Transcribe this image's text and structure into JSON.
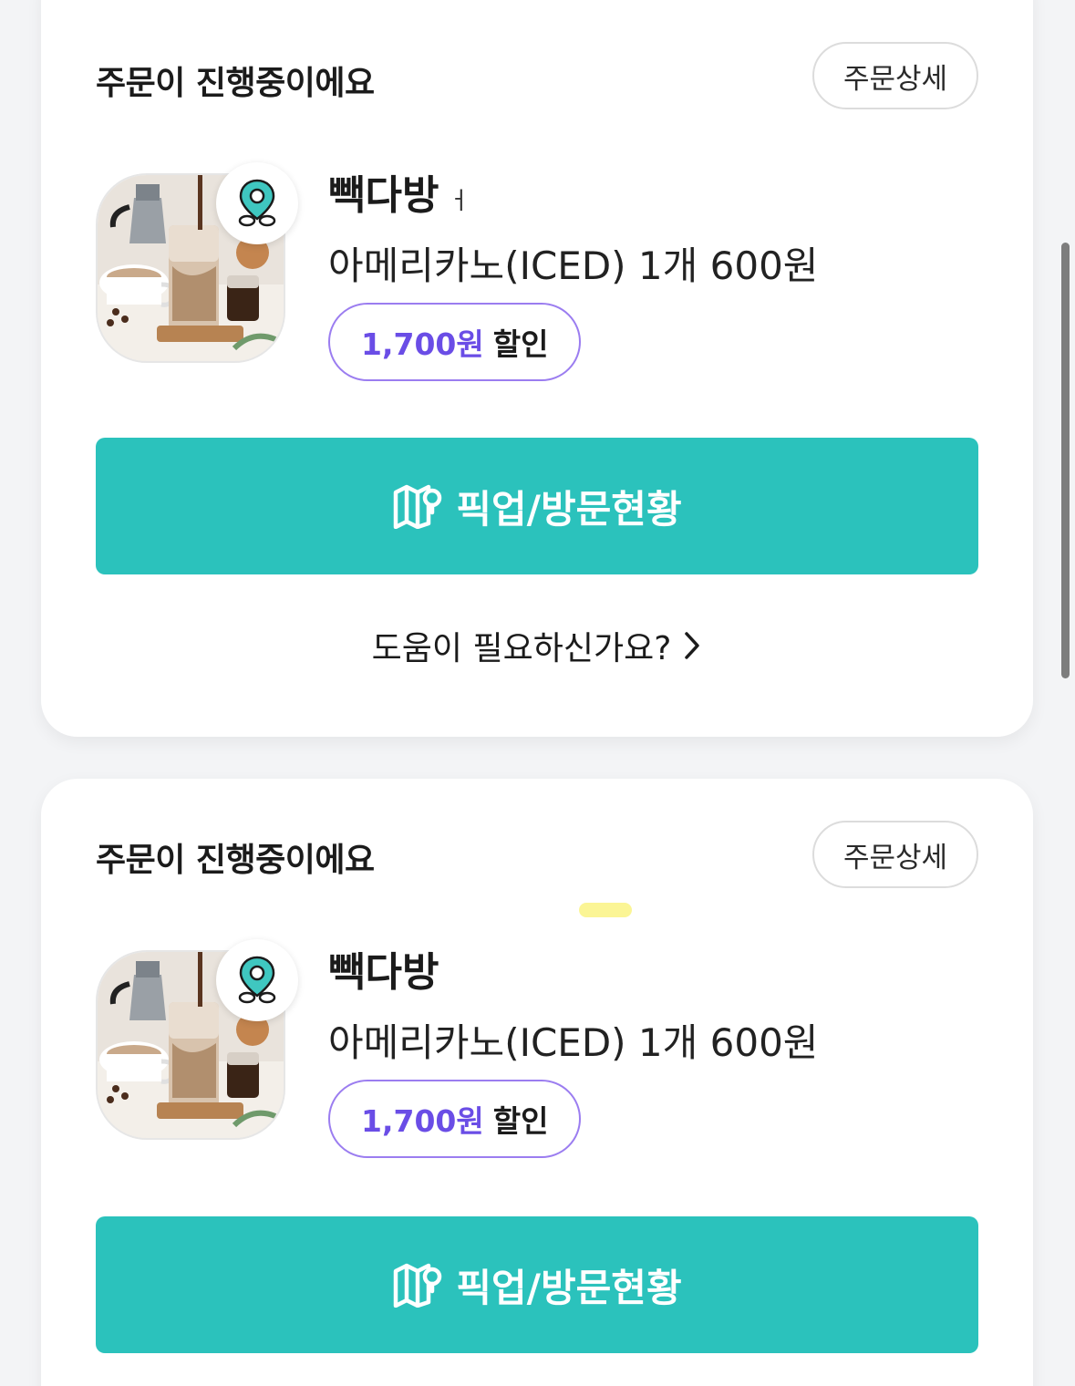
{
  "orders": [
    {
      "status_title": "주문이 진행중이에요",
      "detail_button": "주문상세",
      "store_name": "빽다방",
      "store_trail": "ㅓ",
      "menu_summary": "아메리카노(ICED) 1개 600원",
      "discount_amount": "1,700원",
      "discount_suffix": "할인",
      "pickup_button": "픽업/방문현황",
      "help_link": "도움이 필요하신가요?"
    },
    {
      "status_title": "주문이 진행중이에요",
      "detail_button": "주문상세",
      "store_name": "빽다방",
      "menu_summary": "아메리카노(ICED) 1개 600원",
      "discount_amount": "1,700원",
      "discount_suffix": "할인",
      "pickup_button": "픽업/방문현황"
    }
  ],
  "colors": {
    "accent_teal": "#2bc2bc",
    "discount_purple": "#6a4de6",
    "pill_border": "#9b7df0",
    "pin_icon": "#3fc7c0"
  },
  "icons": {
    "pin_badge": "pickup-pin-icon",
    "pickup_button": "map-pin-icon",
    "help_chevron": "chevron-right-icon"
  }
}
